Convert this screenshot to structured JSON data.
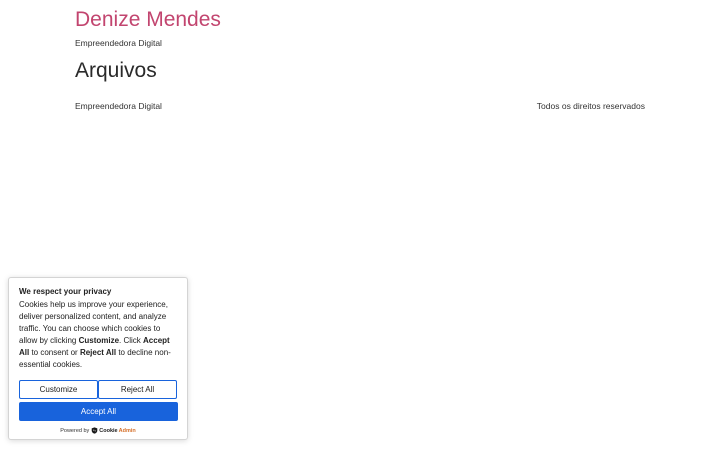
{
  "header": {
    "site_title": "Denize Mendes",
    "tagline": "Empreendedora Digital"
  },
  "main": {
    "heading": "Arquivos"
  },
  "footer": {
    "left_text": "Empreendedora Digital",
    "right_text": "Todos os direitos reservados"
  },
  "cookie_banner": {
    "title": "We respect your privacy",
    "text_1": "Cookies help us improve your experience, deliver personalized content, and analyze traffic. You can choose which cookies to allow by clicking ",
    "bold_customize": "Customize",
    "text_2": ". Click ",
    "bold_accept_all": "Accept All",
    "text_3": " to consent or ",
    "bold_reject_all": "Reject All",
    "text_4": " to decline non-essential cookies.",
    "customize_label": "Customize",
    "reject_label": "Reject All",
    "accept_label": "Accept All",
    "powered_by": "Powered by",
    "brand_cookie": "Cookie",
    "brand_admin": "Admin",
    "accent_color": "#1863dc"
  },
  "colors": {
    "site_title": "#c2456f"
  }
}
